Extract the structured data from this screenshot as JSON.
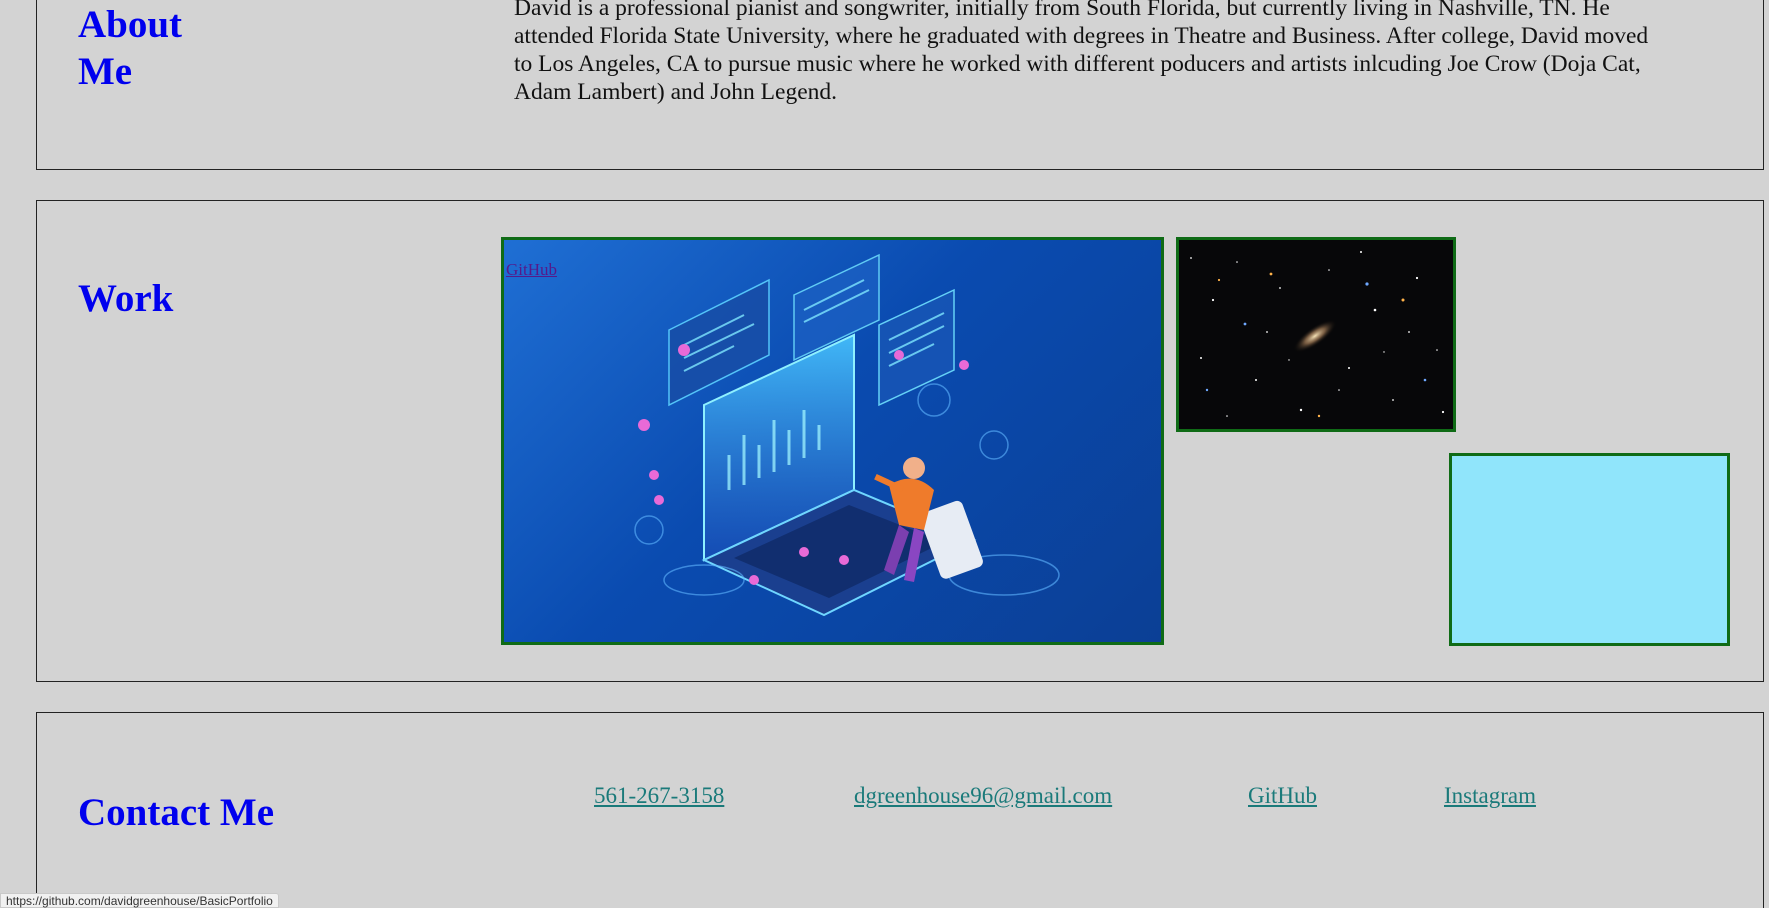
{
  "about": {
    "title": "About Me",
    "text": "David is a professional pianist and songwriter, initially from South Florida, but currently living in Nashville, TN. He attended Florida State University, where he graduated with degrees in Theatre and Business. After college, David moved to Los Angeles, CA to pursue music where he worked with different poducers and artists inlcuding Joe Crow (Doja Cat, Adam Lambert) and John Legend."
  },
  "work": {
    "title": "Work",
    "cards": [
      {
        "link_text": "GitHub",
        "image": "developer-laptop-illustration"
      },
      {
        "image": "galaxy-starfield"
      },
      {
        "image": "blank-cyan-panel"
      }
    ]
  },
  "contact": {
    "title": "Contact Me",
    "phone": "561-267-3158",
    "email": "dgreenhouse96@gmail.com",
    "github": "GitHub",
    "instagram": "Instagram"
  },
  "status_bar": {
    "url": "https://github.com/davidgreenhouse/BasicPortfolio"
  },
  "colors": {
    "background": "#d3d3d3",
    "heading": "#0000ee",
    "link": "#1a7a7a",
    "visited_link": "#551a8b",
    "card_border": "#0f6b16",
    "cyan_card": "#90e5fb"
  }
}
